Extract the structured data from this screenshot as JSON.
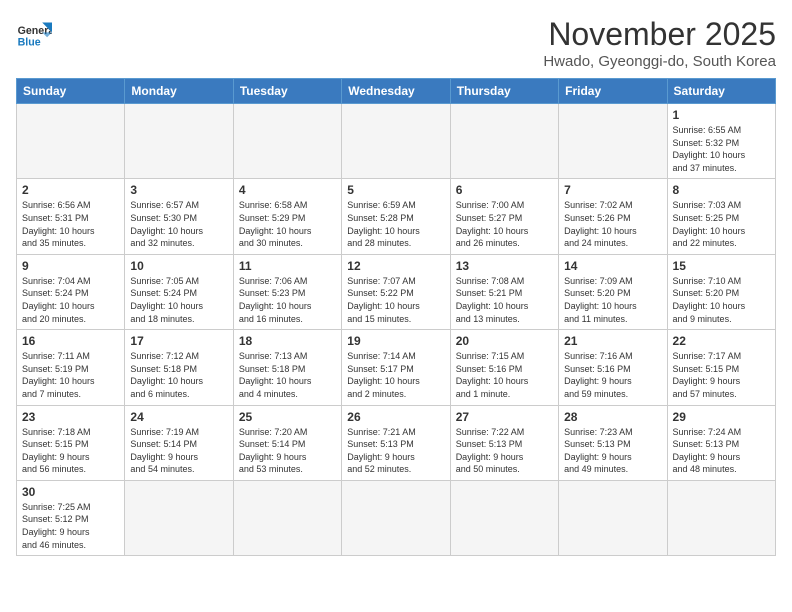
{
  "header": {
    "logo_general": "General",
    "logo_blue": "Blue",
    "month_title": "November 2025",
    "location": "Hwado, Gyeonggi-do, South Korea"
  },
  "weekdays": [
    "Sunday",
    "Monday",
    "Tuesday",
    "Wednesday",
    "Thursday",
    "Friday",
    "Saturday"
  ],
  "weeks": [
    [
      {
        "day": "",
        "info": ""
      },
      {
        "day": "",
        "info": ""
      },
      {
        "day": "",
        "info": ""
      },
      {
        "day": "",
        "info": ""
      },
      {
        "day": "",
        "info": ""
      },
      {
        "day": "",
        "info": ""
      },
      {
        "day": "1",
        "info": "Sunrise: 6:55 AM\nSunset: 5:32 PM\nDaylight: 10 hours\nand 37 minutes."
      }
    ],
    [
      {
        "day": "2",
        "info": "Sunrise: 6:56 AM\nSunset: 5:31 PM\nDaylight: 10 hours\nand 35 minutes."
      },
      {
        "day": "3",
        "info": "Sunrise: 6:57 AM\nSunset: 5:30 PM\nDaylight: 10 hours\nand 32 minutes."
      },
      {
        "day": "4",
        "info": "Sunrise: 6:58 AM\nSunset: 5:29 PM\nDaylight: 10 hours\nand 30 minutes."
      },
      {
        "day": "5",
        "info": "Sunrise: 6:59 AM\nSunset: 5:28 PM\nDaylight: 10 hours\nand 28 minutes."
      },
      {
        "day": "6",
        "info": "Sunrise: 7:00 AM\nSunset: 5:27 PM\nDaylight: 10 hours\nand 26 minutes."
      },
      {
        "day": "7",
        "info": "Sunrise: 7:02 AM\nSunset: 5:26 PM\nDaylight: 10 hours\nand 24 minutes."
      },
      {
        "day": "8",
        "info": "Sunrise: 7:03 AM\nSunset: 5:25 PM\nDaylight: 10 hours\nand 22 minutes."
      }
    ],
    [
      {
        "day": "9",
        "info": "Sunrise: 7:04 AM\nSunset: 5:24 PM\nDaylight: 10 hours\nand 20 minutes."
      },
      {
        "day": "10",
        "info": "Sunrise: 7:05 AM\nSunset: 5:24 PM\nDaylight: 10 hours\nand 18 minutes."
      },
      {
        "day": "11",
        "info": "Sunrise: 7:06 AM\nSunset: 5:23 PM\nDaylight: 10 hours\nand 16 minutes."
      },
      {
        "day": "12",
        "info": "Sunrise: 7:07 AM\nSunset: 5:22 PM\nDaylight: 10 hours\nand 15 minutes."
      },
      {
        "day": "13",
        "info": "Sunrise: 7:08 AM\nSunset: 5:21 PM\nDaylight: 10 hours\nand 13 minutes."
      },
      {
        "day": "14",
        "info": "Sunrise: 7:09 AM\nSunset: 5:20 PM\nDaylight: 10 hours\nand 11 minutes."
      },
      {
        "day": "15",
        "info": "Sunrise: 7:10 AM\nSunset: 5:20 PM\nDaylight: 10 hours\nand 9 minutes."
      }
    ],
    [
      {
        "day": "16",
        "info": "Sunrise: 7:11 AM\nSunset: 5:19 PM\nDaylight: 10 hours\nand 7 minutes."
      },
      {
        "day": "17",
        "info": "Sunrise: 7:12 AM\nSunset: 5:18 PM\nDaylight: 10 hours\nand 6 minutes."
      },
      {
        "day": "18",
        "info": "Sunrise: 7:13 AM\nSunset: 5:18 PM\nDaylight: 10 hours\nand 4 minutes."
      },
      {
        "day": "19",
        "info": "Sunrise: 7:14 AM\nSunset: 5:17 PM\nDaylight: 10 hours\nand 2 minutes."
      },
      {
        "day": "20",
        "info": "Sunrise: 7:15 AM\nSunset: 5:16 PM\nDaylight: 10 hours\nand 1 minute."
      },
      {
        "day": "21",
        "info": "Sunrise: 7:16 AM\nSunset: 5:16 PM\nDaylight: 9 hours\nand 59 minutes."
      },
      {
        "day": "22",
        "info": "Sunrise: 7:17 AM\nSunset: 5:15 PM\nDaylight: 9 hours\nand 57 minutes."
      }
    ],
    [
      {
        "day": "23",
        "info": "Sunrise: 7:18 AM\nSunset: 5:15 PM\nDaylight: 9 hours\nand 56 minutes."
      },
      {
        "day": "24",
        "info": "Sunrise: 7:19 AM\nSunset: 5:14 PM\nDaylight: 9 hours\nand 54 minutes."
      },
      {
        "day": "25",
        "info": "Sunrise: 7:20 AM\nSunset: 5:14 PM\nDaylight: 9 hours\nand 53 minutes."
      },
      {
        "day": "26",
        "info": "Sunrise: 7:21 AM\nSunset: 5:13 PM\nDaylight: 9 hours\nand 52 minutes."
      },
      {
        "day": "27",
        "info": "Sunrise: 7:22 AM\nSunset: 5:13 PM\nDaylight: 9 hours\nand 50 minutes."
      },
      {
        "day": "28",
        "info": "Sunrise: 7:23 AM\nSunset: 5:13 PM\nDaylight: 9 hours\nand 49 minutes."
      },
      {
        "day": "29",
        "info": "Sunrise: 7:24 AM\nSunset: 5:13 PM\nDaylight: 9 hours\nand 48 minutes."
      }
    ],
    [
      {
        "day": "30",
        "info": "Sunrise: 7:25 AM\nSunset: 5:12 PM\nDaylight: 9 hours\nand 46 minutes."
      },
      {
        "day": "",
        "info": ""
      },
      {
        "day": "",
        "info": ""
      },
      {
        "day": "",
        "info": ""
      },
      {
        "day": "",
        "info": ""
      },
      {
        "day": "",
        "info": ""
      },
      {
        "day": "",
        "info": ""
      }
    ]
  ]
}
